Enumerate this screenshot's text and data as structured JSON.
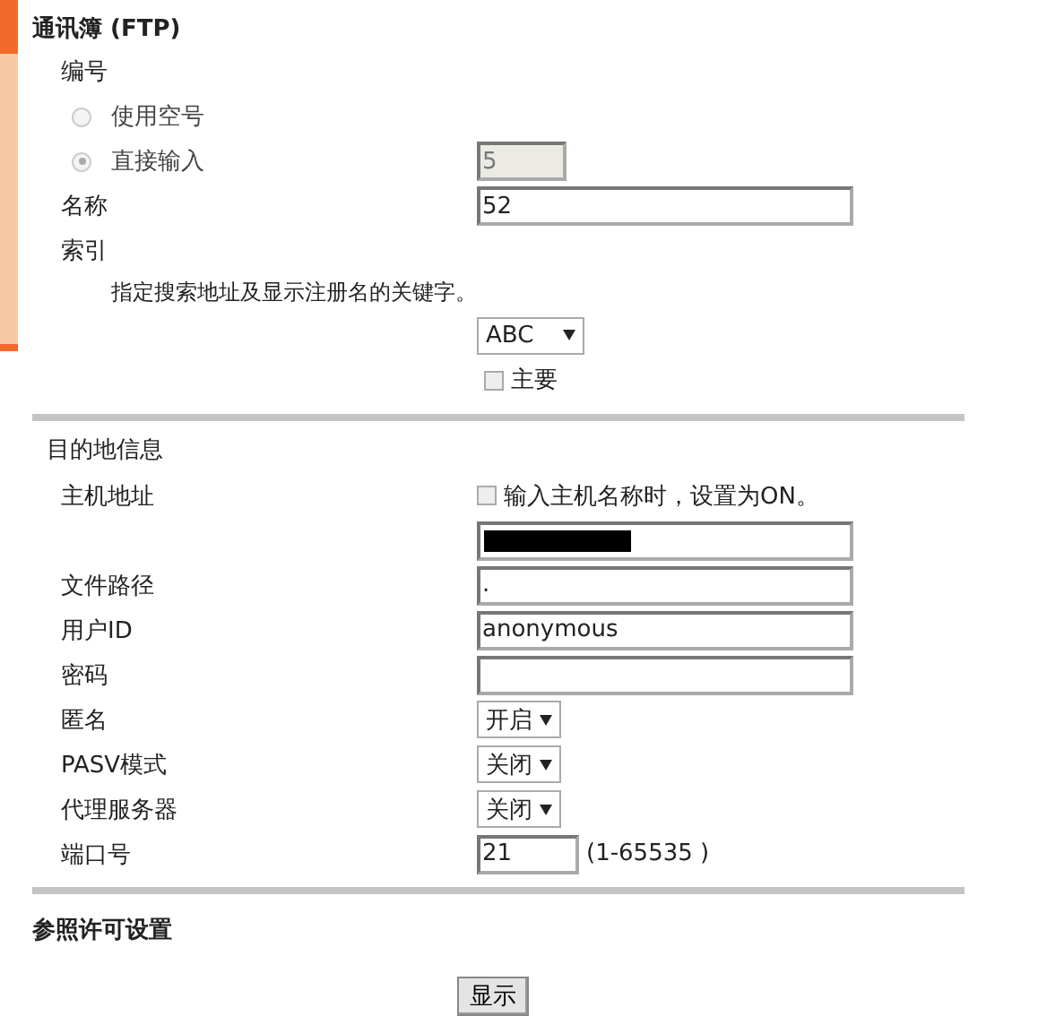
{
  "title": "通讯簿 (FTP)",
  "number": {
    "label": "编号",
    "disabled": true,
    "value": "5",
    "options": [
      {
        "label": "使用空号",
        "selected": false
      },
      {
        "label": "直接输入",
        "selected": true
      }
    ]
  },
  "name": {
    "label": "名称",
    "value": "52"
  },
  "index": {
    "label": "索引",
    "hint": "指定搜索地址及显示注册名的关键字。",
    "value": "ABC",
    "primary": {
      "label": "主要",
      "checked": false
    }
  },
  "destination": {
    "heading": "目的地信息",
    "fields": [
      {
        "kind": "host",
        "label": "主机地址",
        "checkbox": {
          "label": "输入主机名称时，设置为ON。",
          "checked": false
        },
        "redacted": true
      },
      {
        "kind": "text",
        "label": "文件路径",
        "value": "."
      },
      {
        "kind": "text",
        "label": "用户ID",
        "value": "anonymous"
      },
      {
        "kind": "text",
        "label": "密码"
      },
      {
        "kind": "select",
        "label": "匿名",
        "value": "开启"
      },
      {
        "kind": "select",
        "label": "PASV模式",
        "value": "关闭"
      },
      {
        "kind": "select",
        "label": "代理服务器",
        "value": "关闭"
      },
      {
        "kind": "port",
        "label": "端口号",
        "value": "21",
        "range": "(1-65535 )"
      }
    ]
  },
  "reference": {
    "heading": "参照许可设置",
    "button": "显示"
  }
}
